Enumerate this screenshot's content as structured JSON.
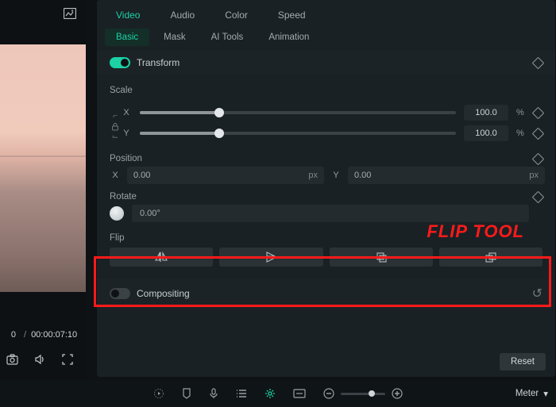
{
  "preview": {
    "current_time": "0",
    "total_time": "00:00:07:10"
  },
  "main_tabs": [
    "Video",
    "Audio",
    "Color",
    "Speed"
  ],
  "sub_tabs": [
    "Basic",
    "Mask",
    "AI Tools",
    "Animation"
  ],
  "transform": {
    "label": "Transform",
    "scale_label": "Scale",
    "axes": {
      "x": "X",
      "y": "Y"
    },
    "scale_x": {
      "value": "100.0",
      "unit": "%"
    },
    "scale_y": {
      "value": "100.0",
      "unit": "%"
    },
    "position_label": "Position",
    "pos_x_axis": "X",
    "pos_y_axis": "Y",
    "pos_x": "0.00",
    "pos_y": "0.00",
    "pos_unit": "px",
    "rotate_label": "Rotate",
    "rotate_value": "0.00°",
    "flip_label": "Flip"
  },
  "compositing": {
    "label": "Compositing"
  },
  "reset_label": "Reset",
  "annotation": "FLIP TOOL",
  "bottom": {
    "meter_label": "Meter"
  }
}
